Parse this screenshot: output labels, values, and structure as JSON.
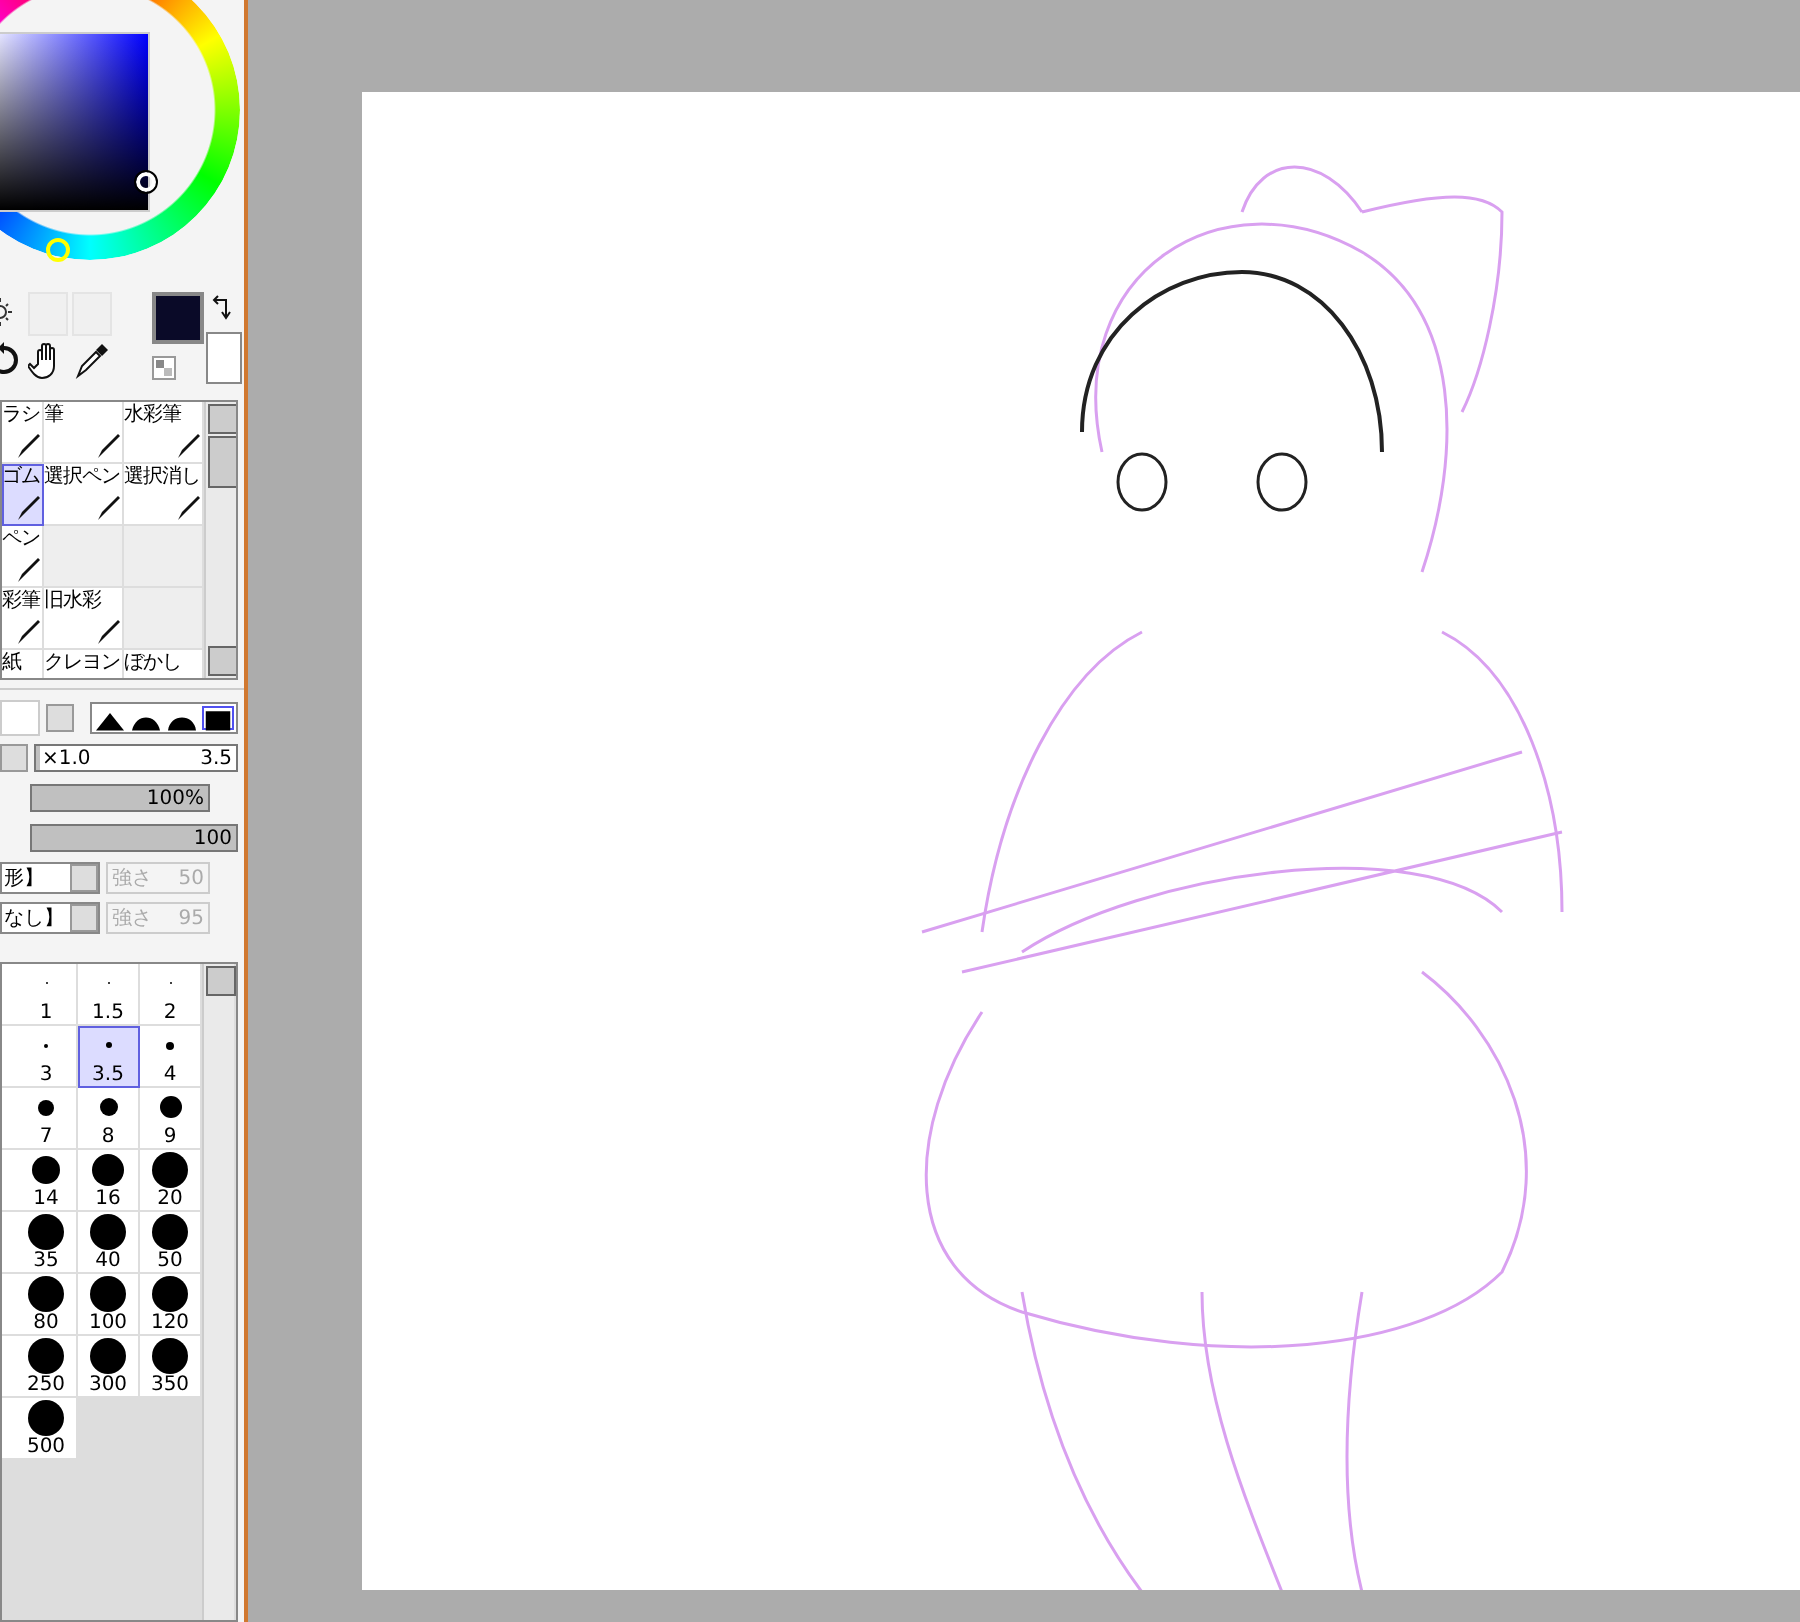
{
  "tools": [
    {
      "label": "ラシ",
      "selected": false
    },
    {
      "label": "筆",
      "selected": false
    },
    {
      "label": "水彩筆",
      "selected": false
    },
    {
      "label": "ゴム",
      "selected": true
    },
    {
      "label": "選択ペン",
      "selected": false
    },
    {
      "label": "選択消し",
      "selected": false
    },
    {
      "label": "ペン",
      "selected": false
    },
    {
      "selected": false
    },
    {
      "selected": false
    },
    {
      "label": "彩筆",
      "selected": false
    },
    {
      "label": "旧水彩",
      "selected": false
    },
    {
      "selected": false
    },
    {
      "label": "紙",
      "selected": false
    },
    {
      "label": "クレヨン",
      "selected": false
    },
    {
      "label": "ぼかし",
      "selected": false
    }
  ],
  "brush_shapes": [
    {
      "selected": false
    },
    {
      "selected": false
    },
    {
      "selected": false
    },
    {
      "selected": true
    }
  ],
  "size": {
    "multiplier": "×1.0",
    "value": "3.5",
    "level": 0.02
  },
  "density": {
    "value": "100%",
    "level": 1
  },
  "sharpness": {
    "value": "100",
    "level": 1
  },
  "texture": {
    "label": "形】",
    "strength_label": "強さ",
    "strength": "50",
    "disabled": true
  },
  "blending": {
    "label": "なし】",
    "strength_label": "強さ",
    "strength": "95",
    "disabled": true
  },
  "brush_sizes": [
    {
      "label": "1",
      "selected": false
    },
    {
      "label": "1.5",
      "selected": false
    },
    {
      "label": "2",
      "selected": false
    },
    {
      "label": "3",
      "selected": false
    },
    {
      "label": "3.5",
      "selected": true
    },
    {
      "label": "4",
      "selected": false
    },
    {
      "label": "7",
      "selected": false
    },
    {
      "label": "8",
      "selected": false
    },
    {
      "label": "9",
      "selected": false
    },
    {
      "label": "14",
      "selected": false
    },
    {
      "label": "16",
      "selected": false
    },
    {
      "label": "20",
      "selected": false
    },
    {
      "label": "35",
      "selected": false
    },
    {
      "label": "40",
      "selected": false
    },
    {
      "label": "50",
      "selected": false
    },
    {
      "label": "80",
      "selected": false
    },
    {
      "label": "100",
      "selected": false
    },
    {
      "label": "120",
      "selected": false
    },
    {
      "label": "250",
      "selected": false
    },
    {
      "label": "300",
      "selected": false
    },
    {
      "label": "350",
      "selected": false
    },
    {
      "label": "500",
      "selected": false
    }
  ]
}
